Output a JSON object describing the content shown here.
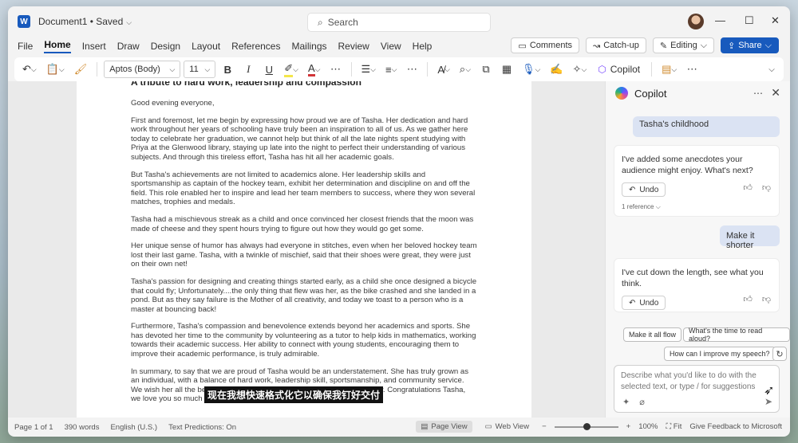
{
  "titlebar": {
    "doc_name": "Document1 • Saved",
    "search_placeholder": "Search",
    "minimize": "—",
    "maximize": "☐",
    "close": "✕"
  },
  "menu": {
    "items": [
      "File",
      "Home",
      "Insert",
      "Draw",
      "Design",
      "Layout",
      "References",
      "Mailings",
      "Review",
      "View",
      "Help"
    ],
    "active": "Home",
    "comments": "Comments",
    "catchup": "Catch-up",
    "editing": "Editing",
    "share": "Share"
  },
  "ribbon": {
    "font_name": "Aptos (Body)",
    "font_size": "11",
    "bold": "B",
    "italic": "I",
    "underline": "U",
    "copilot": "Copilot"
  },
  "document": {
    "title": "A tribute to hard work, leadership and compassion",
    "paragraphs": [
      "Good evening everyone,",
      "First and foremost, let me begin by expressing how proud we are of Tasha. Her dedication and hard work throughout her years of schooling have truly been an inspiration to all of us. As we gather here today to celebrate her graduation, we cannot help but think of all the late nights spent studying with Priya at the Glenwood library, staying up late into the night to perfect their understanding of various subjects. And through this tireless effort, Tasha has hit all her academic goals.",
      "But Tasha's achievements are not limited to academics alone. Her leadership skills and sportsmanship as captain of the hockey team, exhibit her determination and discipline on and off the field. This role enabled her to inspire and lead her team members to success, where they won several matches, trophies and medals.",
      "Tasha had a mischievous streak as a child and once convinced her closest friends that the moon was made of cheese and they spent hours trying to figure out how they would go get some.",
      "Her unique sense of humor has always had everyone in stitches, even when her beloved hockey team lost their last game. Tasha, with a twinkle of mischief, said that their shoes were great, they were just on their own net!",
      "Tasha's passion for designing and creating things started early, as a child she once designed a bicycle that could fly; Unfortunately....the only thing that flew was her, as the bike crashed and she landed in a pond. But as they say failure is the Mother of all creativity, and today we toast to a person who is a master at bouncing back!",
      "Furthermore, Tasha's compassion and benevolence extends beyond her academics and sports. She has devoted her time to the community by volunteering as a tutor to help kids in mathematics, working towards their academic success. Her ability to connect with young students, encouraging them to improve their academic performance, is truly admirable.",
      "In summary, to say that we are proud of Tasha would be an understatement. She has truly grown as an individual, with a balance of hard work, leadership skill, sportsmanship, and community service. We wish her all the best as she sets foot into the next phase of her journey. Congratulations Tasha, we love you so much and can't wait to see what the future holds for you."
    ],
    "subtitle_overlay": "现在我想快速格式化它以确保我钉好交付"
  },
  "copilot": {
    "title": "Copilot",
    "user_msg_1": "Tasha's childhood",
    "ai_msg_1": "I've added some anecdotes your audience might enjoy. What's next?",
    "undo_label": "Undo",
    "reference_label": "1 reference",
    "user_msg_2": "Make it shorter",
    "ai_msg_2": "I've cut down the length, see what you think.",
    "suggestions": [
      "Make it all flow",
      "What's the time to read aloud?",
      "How can I improve my speech?"
    ],
    "prompt_placeholder": "Describe what you'd like to do with the selected text, or type / for suggestions"
  },
  "status": {
    "page": "Page 1 of 1",
    "words": "390 words",
    "language": "English (U.S.)",
    "predictions": "Text Predictions: On",
    "page_view": "Page View",
    "web_view": "Web View",
    "zoom": "100%",
    "zoom_value": 1.0,
    "fit": "Fit",
    "feedback": "Give Feedback to Microsoft"
  }
}
